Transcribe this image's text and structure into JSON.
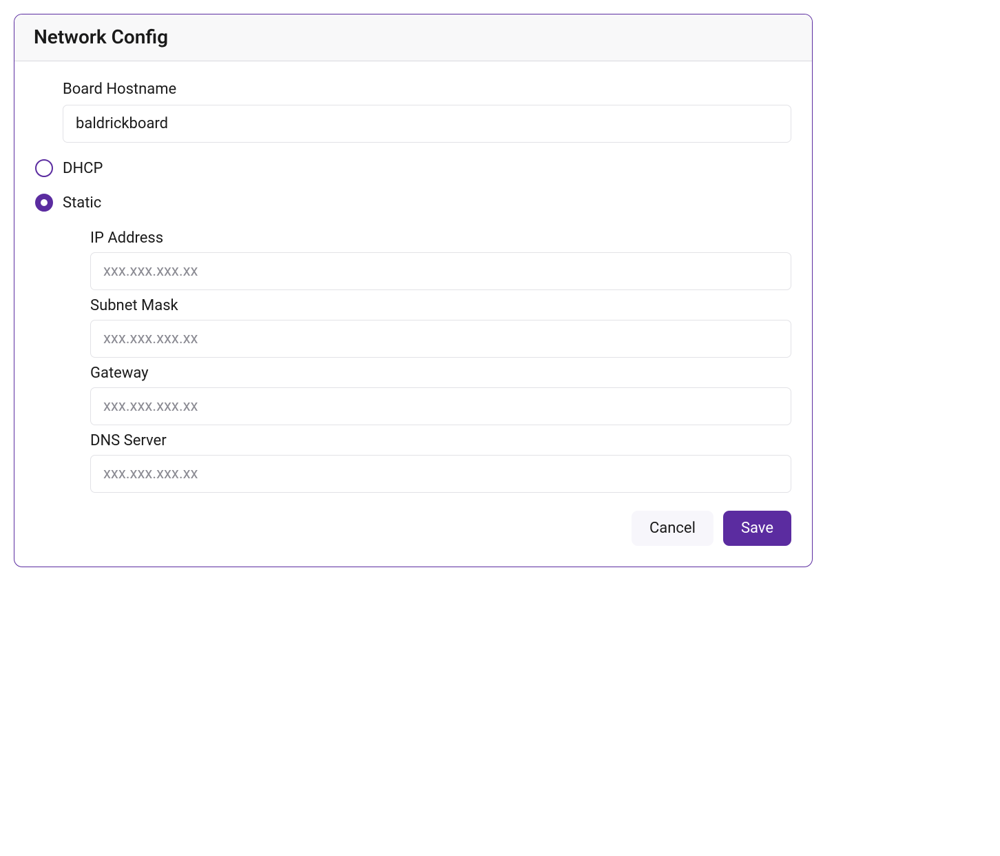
{
  "panel": {
    "title": "Network Config"
  },
  "hostname": {
    "label": "Board Hostname",
    "value": "baldrickboard"
  },
  "mode": {
    "dhcp_label": "DHCP",
    "static_label": "Static",
    "selected": "static"
  },
  "static": {
    "ip": {
      "label": "IP Address",
      "placeholder": "xxx.xxx.xxx.xx",
      "value": ""
    },
    "subnet": {
      "label": "Subnet Mask",
      "placeholder": "xxx.xxx.xxx.xx",
      "value": ""
    },
    "gateway": {
      "label": "Gateway",
      "placeholder": "xxx.xxx.xxx.xx",
      "value": ""
    },
    "dns": {
      "label": "DNS Server",
      "placeholder": "xxx.xxx.xxx.xx",
      "value": ""
    }
  },
  "buttons": {
    "cancel": "Cancel",
    "save": "Save"
  },
  "colors": {
    "accent": "#5b2ca0"
  }
}
